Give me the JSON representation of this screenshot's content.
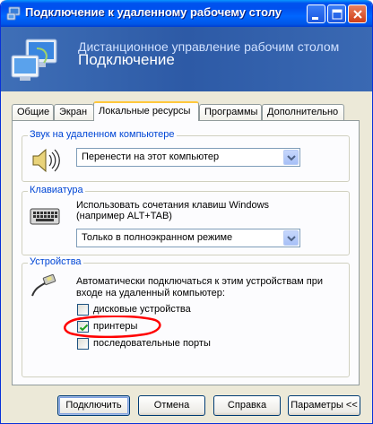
{
  "window": {
    "title": "Подключение к удаленному рабочему столу",
    "controls": {
      "minimize": "minimize-icon",
      "maximize": "maximize-icon",
      "close": "close-icon"
    }
  },
  "banner": {
    "line1": "Дистанционное управление рабочим столом",
    "line2": "Подключение"
  },
  "tabs": [
    {
      "label": "Общие"
    },
    {
      "label": "Экран"
    },
    {
      "label": "Локальные ресурсы",
      "active": true
    },
    {
      "label": "Программы"
    },
    {
      "label": "Дополнительно"
    }
  ],
  "sound": {
    "group_title": "Звук на удаленном компьютере",
    "icon": "speaker-icon",
    "selected": "Перенести на этот компьютер"
  },
  "keyboard": {
    "group_title": "Клавиатура",
    "icon": "keyboard-icon",
    "description_line1": "Использовать сочетания клавиш Windows",
    "description_line2": "(например ALT+TAB)",
    "selected": "Только в полноэкранном режиме"
  },
  "devices": {
    "group_title": "Устройства",
    "icon": "device-plug-icon",
    "description_line1": "Автоматически подключаться к этим устройствам при",
    "description_line2": "входе на удаленный компьютер:",
    "items": [
      {
        "label": "дисковые устройства",
        "checked": false
      },
      {
        "label": "принтеры",
        "checked": true
      },
      {
        "label": "последовательные порты",
        "checked": false
      }
    ]
  },
  "buttons": {
    "connect": "Подключить",
    "cancel": "Отмена",
    "help": "Справка",
    "options": "Параметры <<"
  },
  "colors": {
    "titlebar": "#0055e6",
    "banner": "#3363ad",
    "group_title": "#0046d5",
    "annotation": "#ff0000",
    "check": "#21a121"
  }
}
